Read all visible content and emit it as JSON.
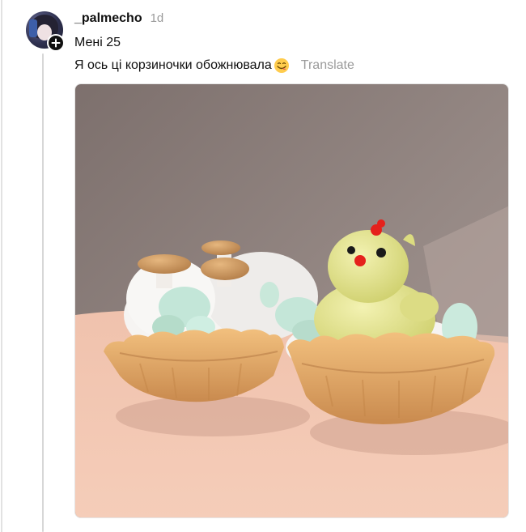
{
  "post": {
    "username": "_palmecho",
    "timestamp": "1d",
    "text_line_1": "Мені 25",
    "text_line_2": "Я ось ці корзиночки обожнювала",
    "emoji": "smiling-face-savoring-food",
    "translate_label": "Translate",
    "avatar_icon": "anime-avatar",
    "follow_icon": "plus-icon"
  },
  "photo": {
    "subject": "two basket tartlets with meringue mushrooms and a yellow chick",
    "colors": {
      "wall": "#8f8380",
      "table": "#f2c7b3",
      "pastry": "#e3a766",
      "cream": "#f6f4f2",
      "chick": "#e6e78f",
      "mint": "#bfe3d3"
    }
  },
  "colors": {
    "text": "#101010",
    "muted": "#9a9a9a",
    "thread_line": "#d7d7d7"
  }
}
